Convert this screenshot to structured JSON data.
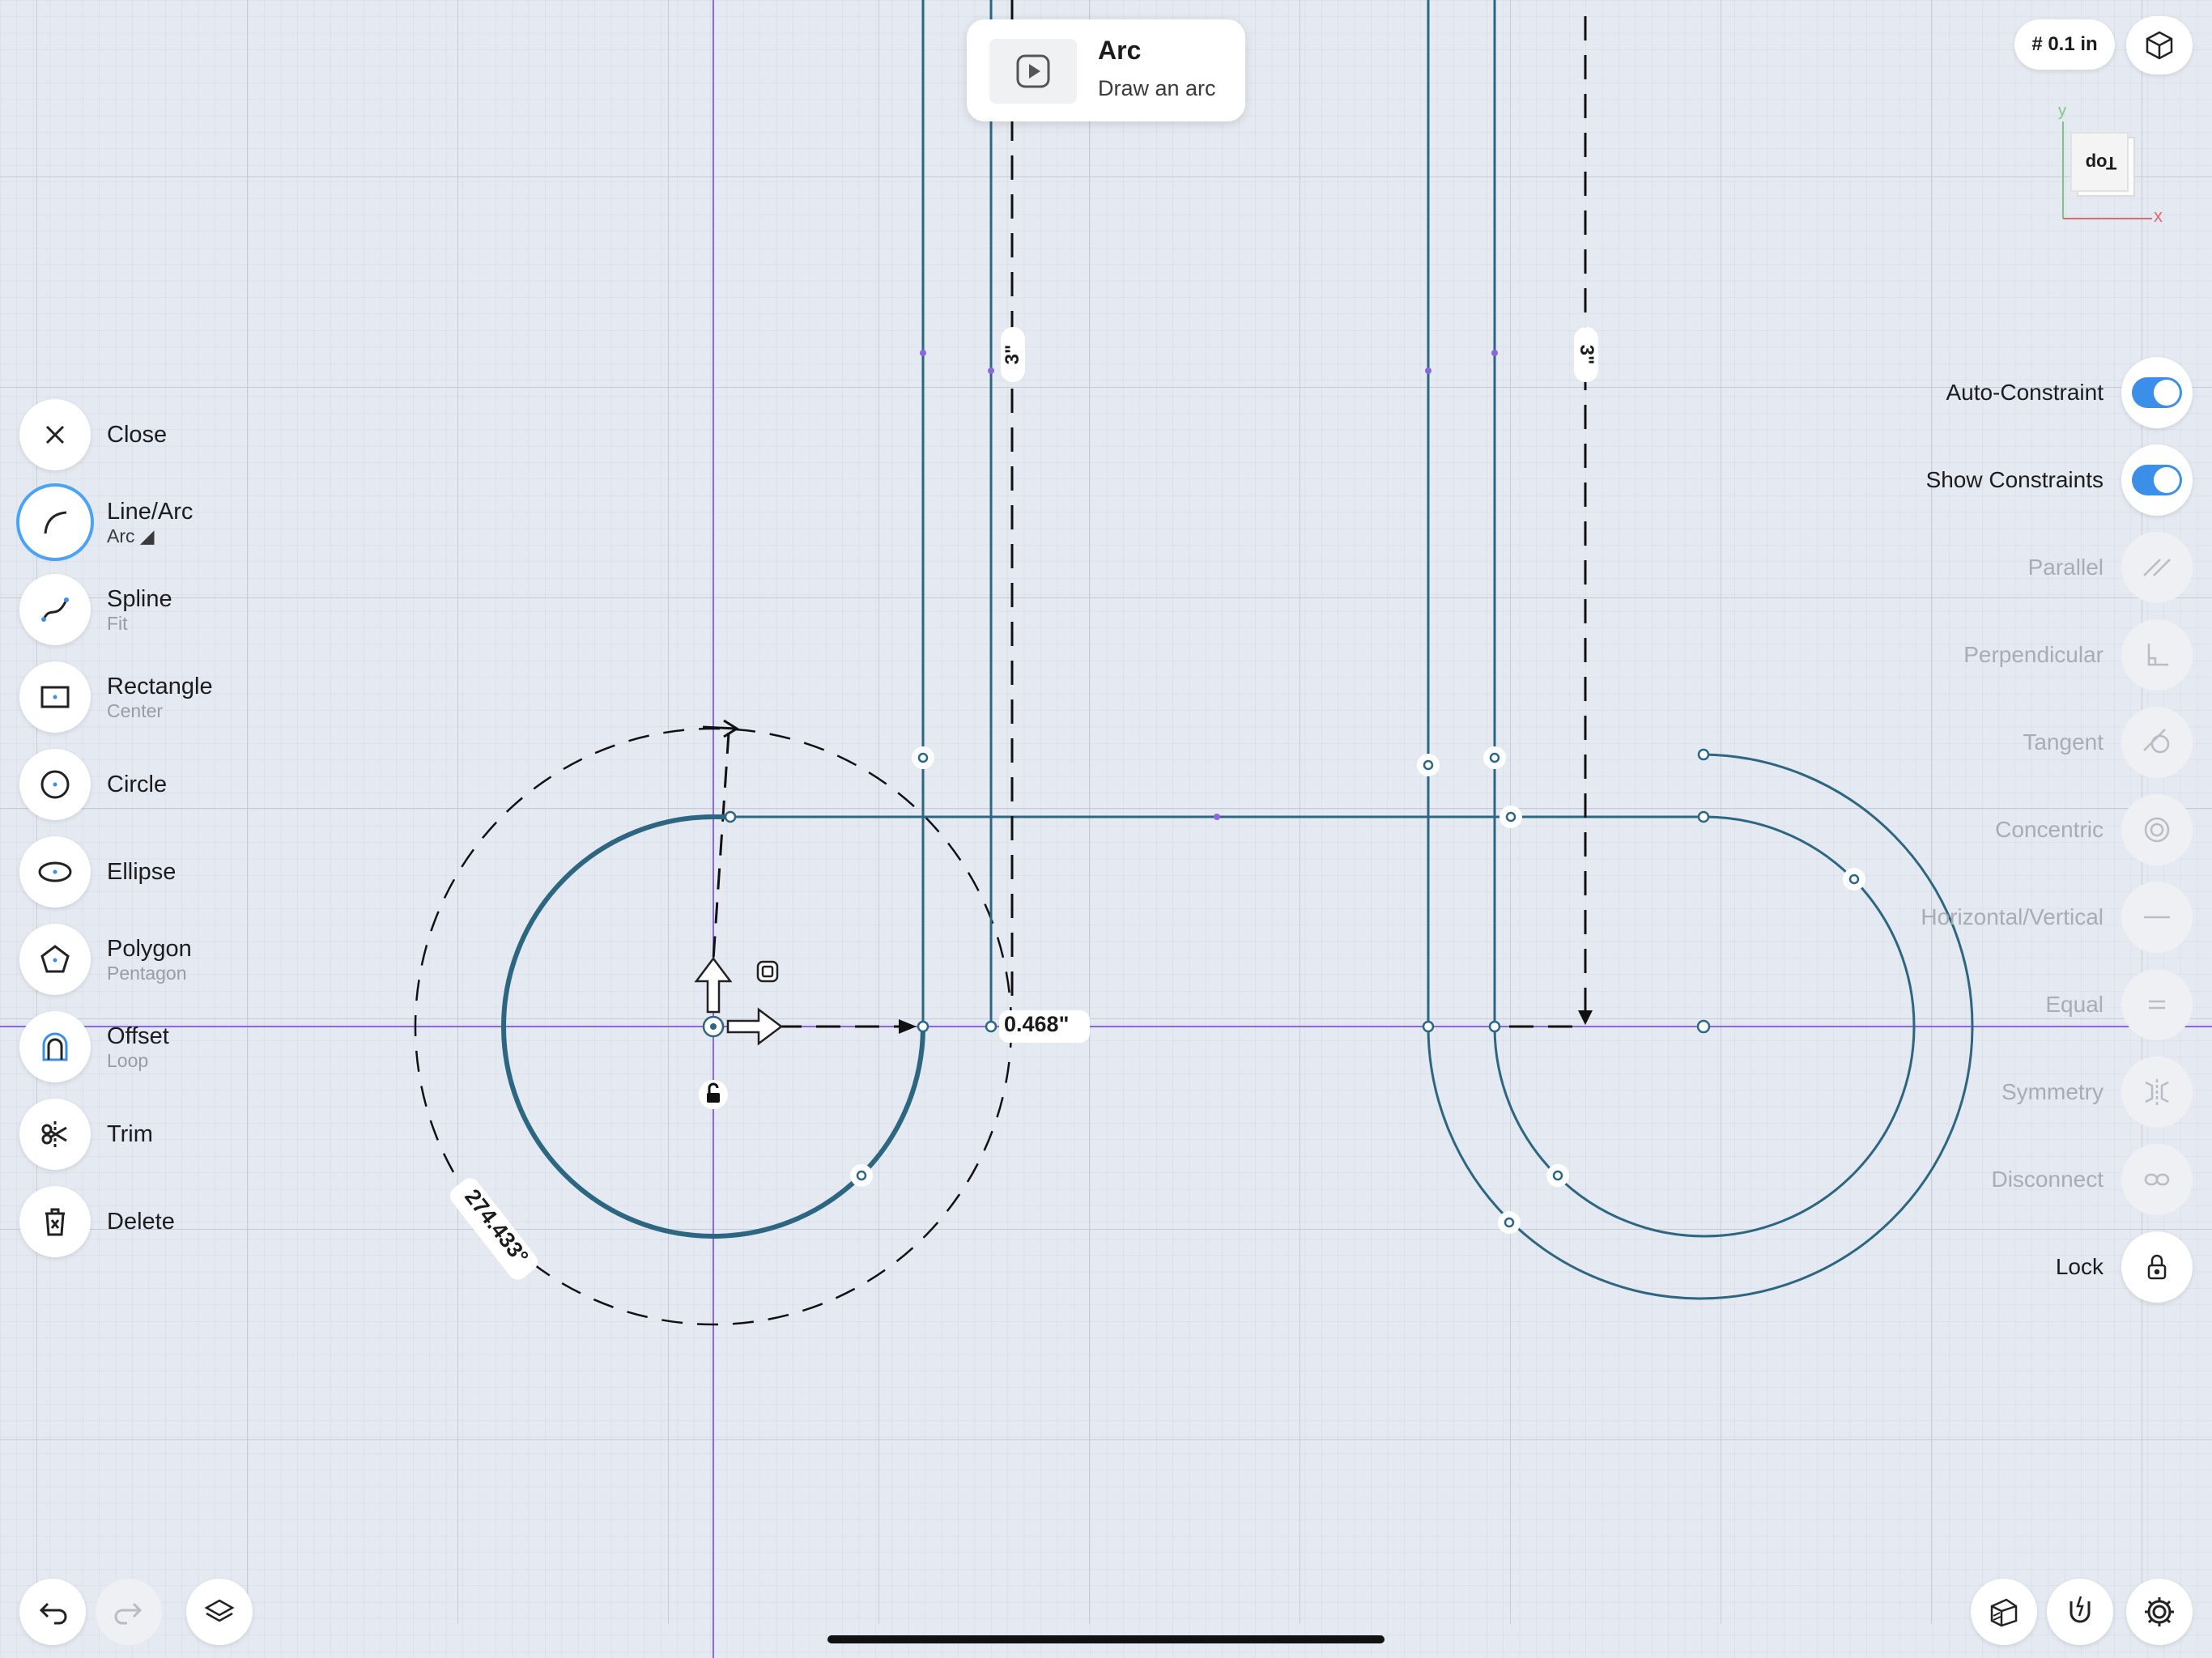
{
  "tooltip": {
    "title": "Arc",
    "subtitle": "Draw an arc"
  },
  "grid_size": "# 0.1 in",
  "view_cube": {
    "face_label": "Top",
    "axis_x": "x",
    "axis_y": "y"
  },
  "tools": [
    {
      "label": "Close",
      "icon": "close-icon"
    },
    {
      "label": "Line/Arc",
      "sub": "Arc",
      "icon": "arc-icon",
      "active": true
    },
    {
      "label": "Spline",
      "sub": "Fit",
      "icon": "spline-icon"
    },
    {
      "label": "Rectangle",
      "sub": "Center",
      "icon": "rectangle-icon"
    },
    {
      "label": "Circle",
      "icon": "circle-icon"
    },
    {
      "label": "Ellipse",
      "icon": "ellipse-icon"
    },
    {
      "label": "Polygon",
      "sub": "Pentagon",
      "icon": "polygon-icon"
    },
    {
      "label": "Offset",
      "sub": "Loop",
      "icon": "offset-icon"
    },
    {
      "label": "Trim",
      "icon": "trim-icon"
    },
    {
      "label": "Delete",
      "icon": "delete-icon"
    }
  ],
  "constraints": {
    "auto_constraint": "Auto-Constraint",
    "show_constraints": "Show Constraints",
    "parallel": "Parallel",
    "perpendicular": "Perpendicular",
    "tangent": "Tangent",
    "concentric": "Concentric",
    "horizontal_vertical": "Horizontal/Vertical",
    "equal": "Equal",
    "symmetry": "Symmetry",
    "disconnect": "Disconnect",
    "lock": "Lock"
  },
  "dimensions": {
    "radius": "0.468\"",
    "angle": "274.433°",
    "left_vertical": "3\"",
    "right_vertical": "3\""
  },
  "colors": {
    "sketch": "#2c6680",
    "accent": "#3b8fe8",
    "axis": "#8a66e0",
    "background": "#e5e9f1"
  }
}
